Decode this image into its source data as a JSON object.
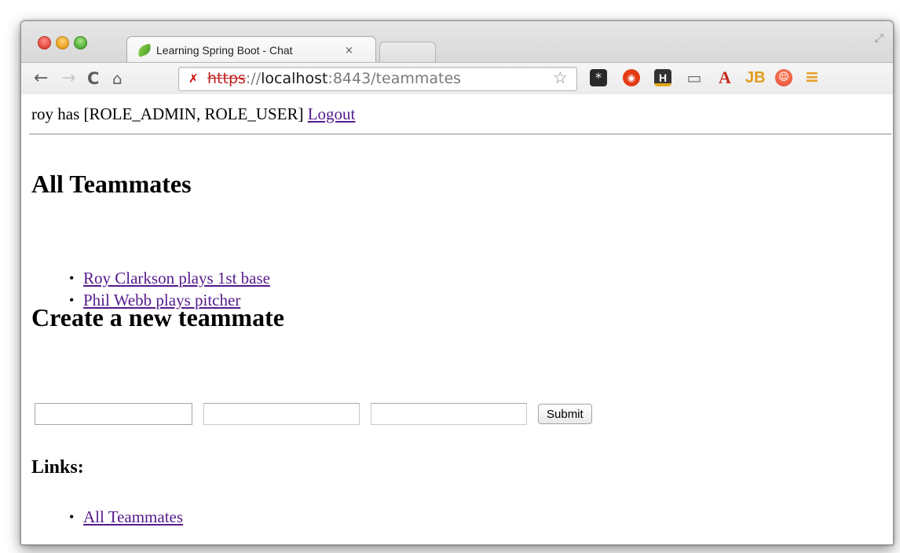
{
  "browser": {
    "tab_title": "Learning Spring Boot - Chat",
    "tab_close": "×",
    "url_scheme": "https",
    "url_sep": "://",
    "url_host": "localhost",
    "url_rest": ":8443/teammates"
  },
  "extensions": [
    "*",
    "◉",
    "H",
    "▭",
    "A",
    "JB",
    "☺",
    "≡"
  ],
  "page": {
    "user_text": "roy has [ROLE_ADMIN, ROLE_USER]",
    "logout": "Logout",
    "all_heading": "All Teammates",
    "teammates": [
      "Roy Clarkson plays 1st base",
      "Phil Webb plays pitcher"
    ],
    "create_heading": "Create a new teammate",
    "form": {
      "field1_value": "",
      "field2_value": "",
      "field3_value": "",
      "submit": "Submit"
    },
    "links_heading": "Links:",
    "links": [
      "All Teammates"
    ]
  }
}
